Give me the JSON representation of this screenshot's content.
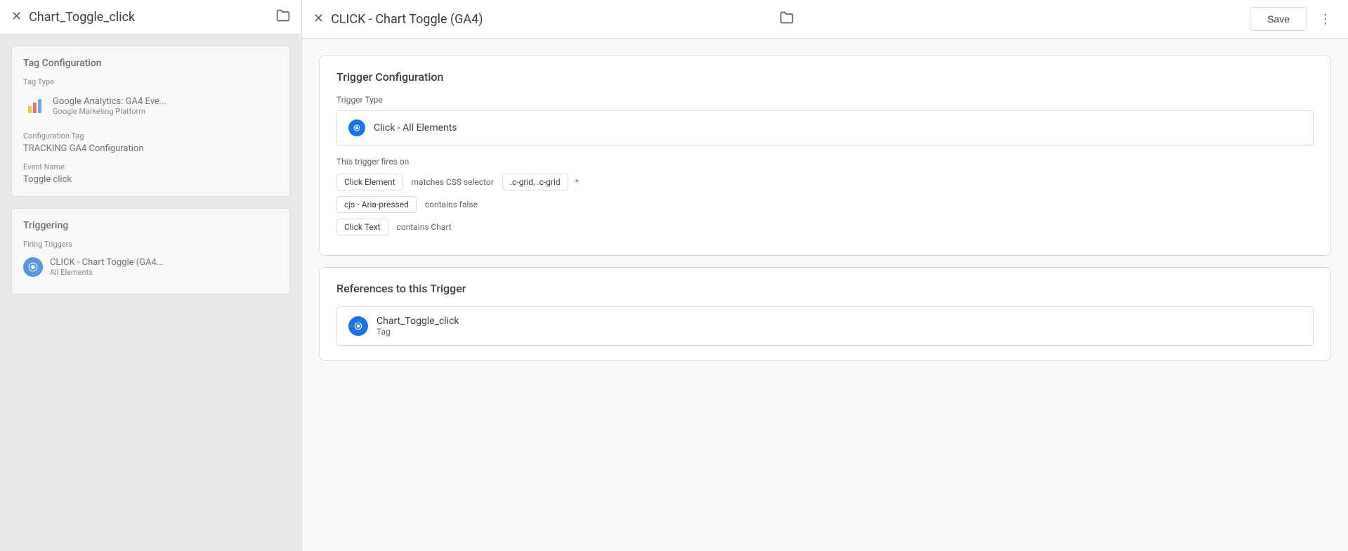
{
  "leftPanel": {
    "title": "Chart_Toggle_click",
    "tagConfiguration": {
      "sectionTitle": "Tag Configuration",
      "tagTypeLabel": "Tag Type",
      "tagName": "Google Analytics: GA4 Eve...",
      "tagPlatform": "Google Marketing Platform",
      "configTagLabel": "Configuration Tag",
      "configTagValue": "TRACKING GA4 Configuration",
      "eventNameLabel": "Event Name",
      "eventNameValue": "Toggle click"
    },
    "triggering": {
      "sectionTitle": "Triggering",
      "firingTriggersLabel": "Firing Triggers",
      "triggerName": "CLICK - Chart Toggle (GA4...",
      "triggerSub": "All Elements"
    }
  },
  "rightPanel": {
    "title": "CLICK - Chart Toggle (GA4)",
    "saveLabel": "Save",
    "moreIcon": "⋮",
    "triggerConfig": {
      "sectionTitle": "Trigger Configuration",
      "triggerTypeLabel": "Trigger Type",
      "triggerTypeName": "Click - All Elements",
      "firesOnLabel": "This trigger fires on",
      "conditions": [
        {
          "variable": "Click Element",
          "operator": "matches CSS selector",
          "value": ".c-grid, .c-grid",
          "hasAsterisk": true
        },
        {
          "variable": "cjs - Aria-pressed",
          "operator": "contains false",
          "value": null,
          "hasAsterisk": false
        },
        {
          "variable": "Click Text",
          "operator": "contains Chart",
          "value": null,
          "hasAsterisk": false
        }
      ]
    },
    "references": {
      "sectionTitle": "References to this Trigger",
      "item": {
        "name": "Chart_Toggle_click",
        "type": "Tag"
      }
    }
  }
}
